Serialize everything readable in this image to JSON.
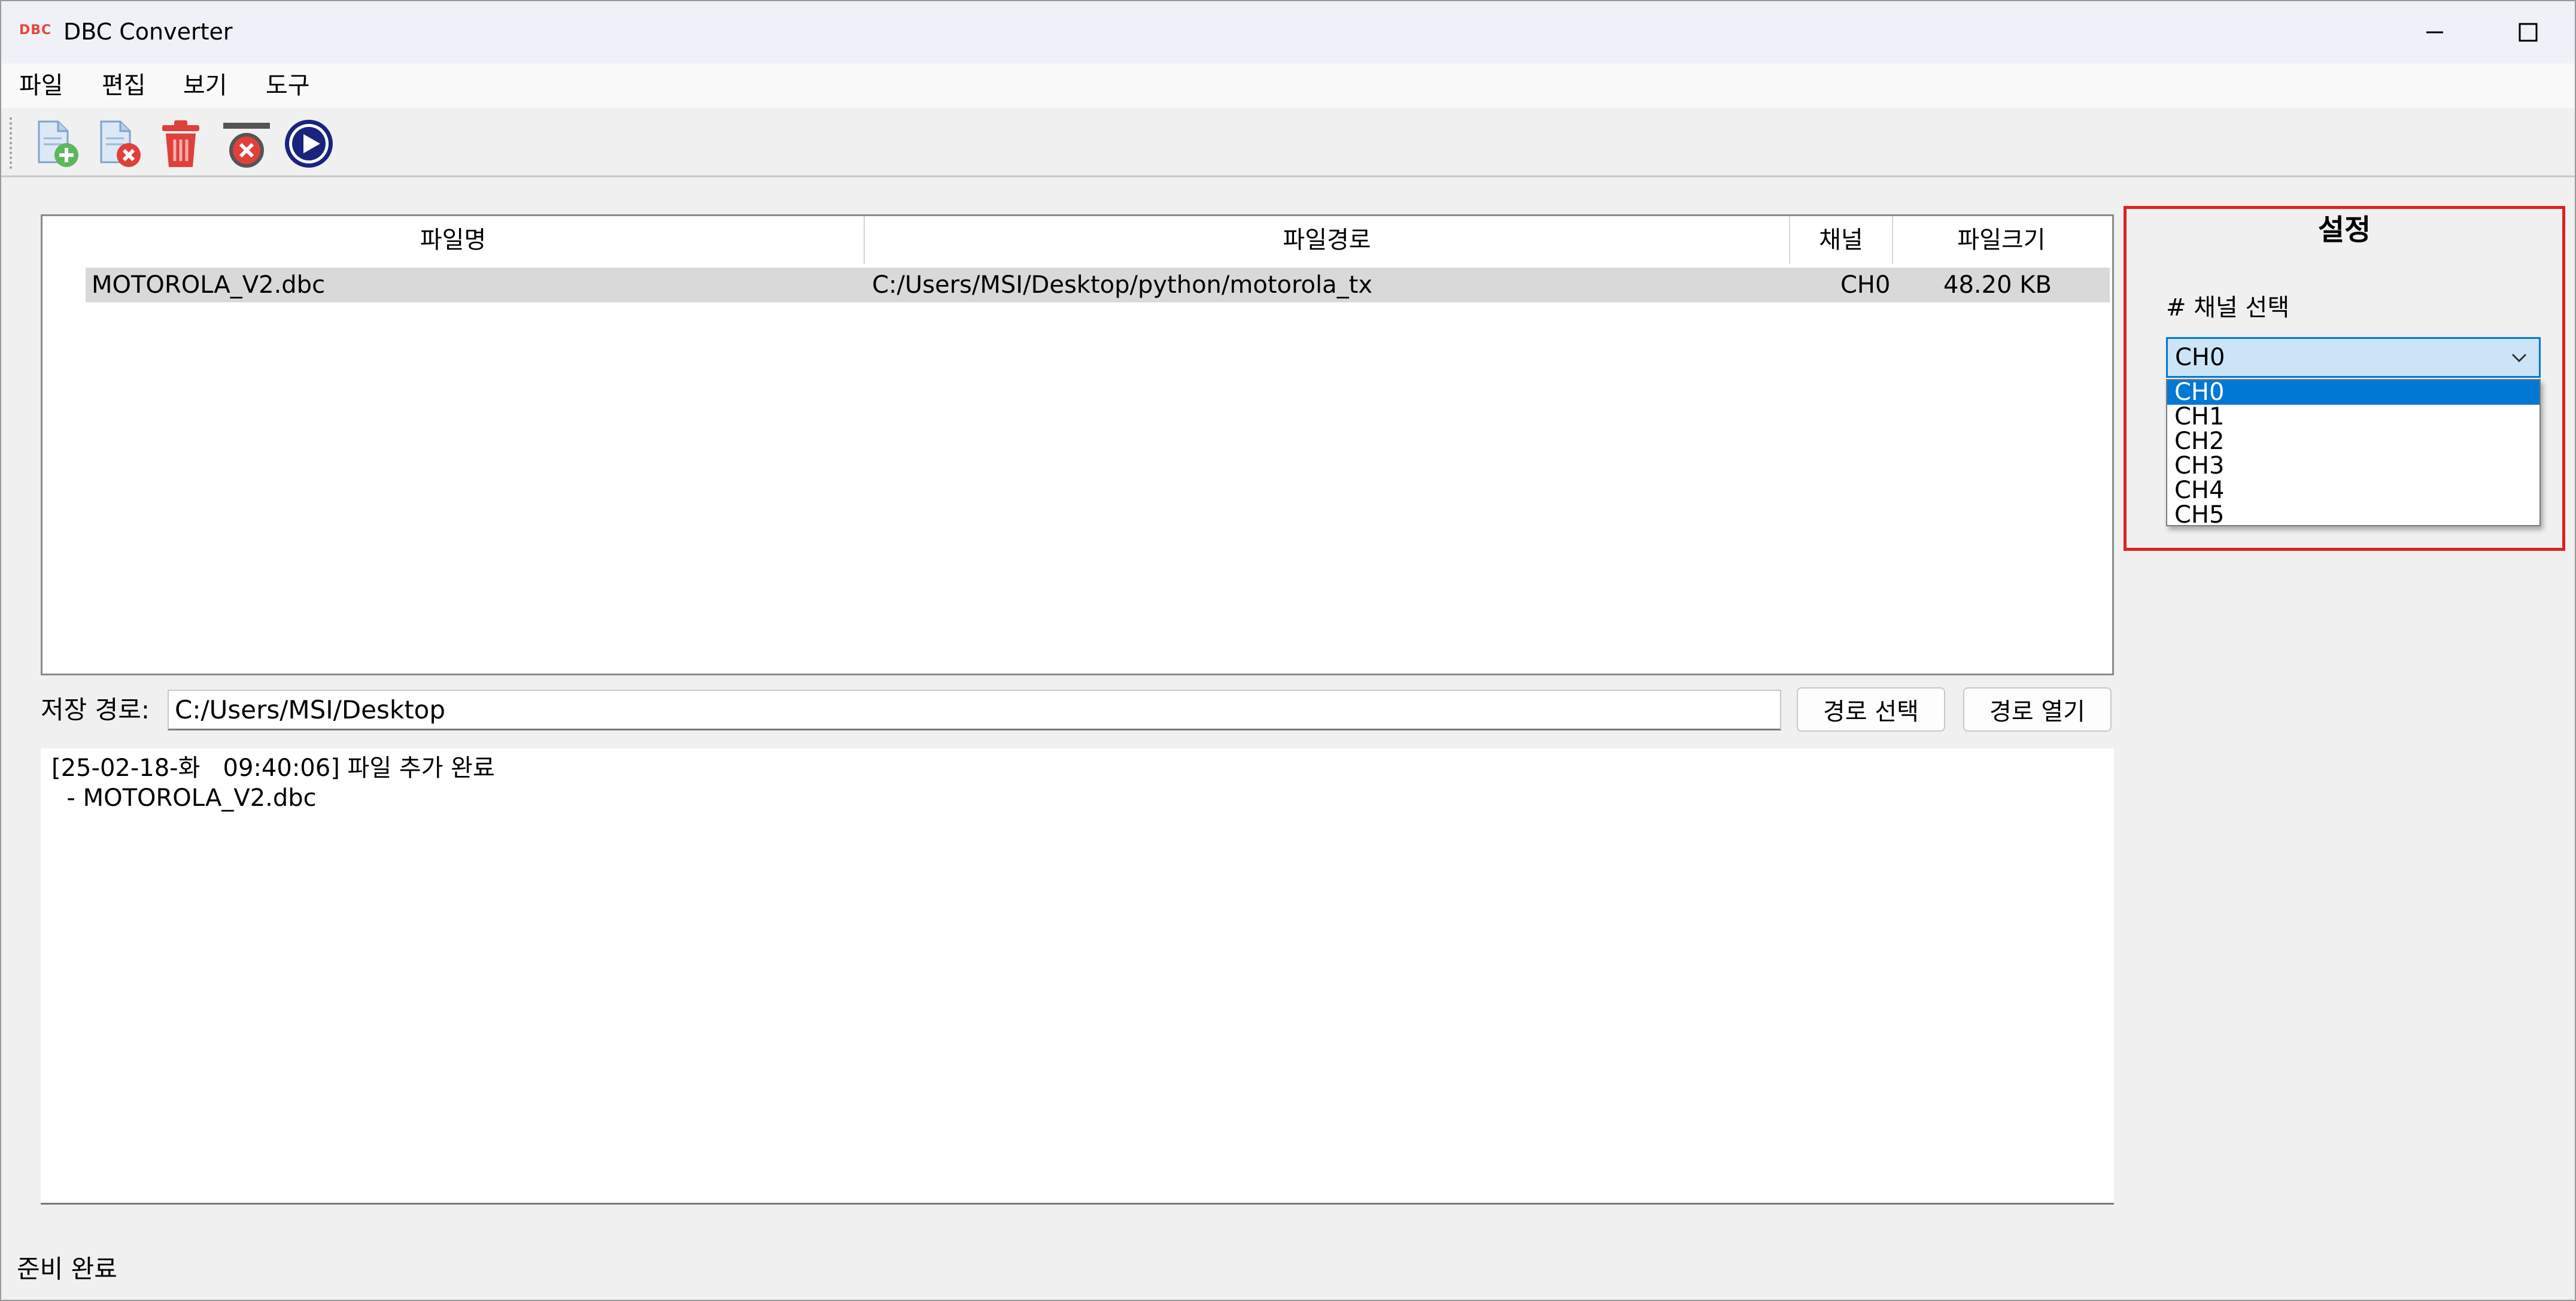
{
  "window": {
    "logo": "DBC",
    "title": "DBC Converter"
  },
  "menu": [
    "파일",
    "편집",
    "보기",
    "도구"
  ],
  "toolbar": {
    "icons": [
      "add-file-icon",
      "remove-file-icon",
      "delete-icon",
      "clear-icon",
      "play-icon"
    ]
  },
  "table": {
    "headers": [
      "파일명",
      "파일경로",
      "채널",
      "파일크기"
    ],
    "rows": [
      {
        "name": "MOTOROLA_V2.dbc",
        "path": "C:/Users/MSI/Desktop/python/motorola_tx",
        "channel": "CH0",
        "size": "48.20 KB"
      }
    ]
  },
  "save": {
    "label": "저장 경로:",
    "path": "C:/Users/MSI/Desktop",
    "select_button": "경로 선택",
    "open_button": "경로 열기"
  },
  "log": {
    "lines": [
      "[25-02-18-화   09:40:06] 파일 추가 완료",
      "  - MOTOROLA_V2.dbc"
    ]
  },
  "status": "준비 완료",
  "settings": {
    "title": "설정",
    "channel_label": "# 채널 선택",
    "selected": "CH0",
    "options": [
      "CH0",
      "CH1",
      "CH2",
      "CH3",
      "CH4",
      "CH5"
    ]
  },
  "colors": {
    "accent": "#0078d4",
    "highlight_border": "#e02020",
    "selected_row": "#d9d9d9"
  }
}
